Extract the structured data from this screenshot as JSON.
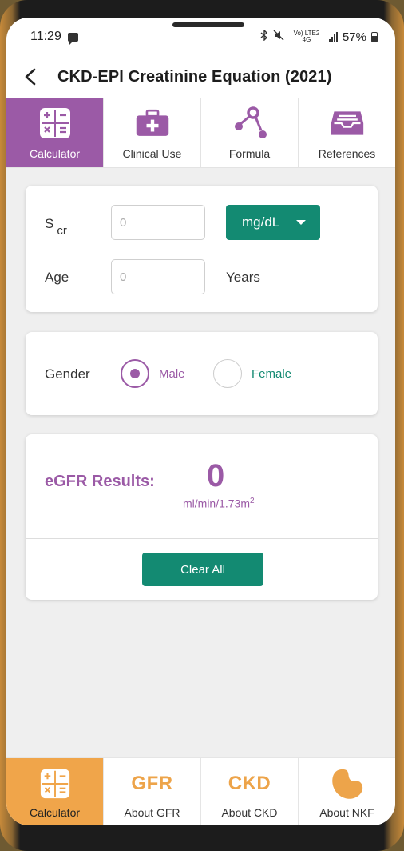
{
  "status_bar": {
    "time": "11:29",
    "indicators": "Vo) LTE2 4G",
    "battery": "57%"
  },
  "header": {
    "title": "CKD-EPI Creatinine Equation (2021)"
  },
  "top_tabs": [
    {
      "label": "Calculator",
      "icon": "calculator-icon",
      "active": true
    },
    {
      "label": "Clinical Use",
      "icon": "medical-kit-icon",
      "active": false
    },
    {
      "label": "Formula",
      "icon": "formula-nodes-icon",
      "active": false
    },
    {
      "label": "References",
      "icon": "inbox-tray-icon",
      "active": false
    }
  ],
  "form": {
    "scr_label_main": "S",
    "scr_label_sub": "cr",
    "scr_placeholder": "0",
    "unit_selected": "mg/dL",
    "age_label": "Age",
    "age_placeholder": "0",
    "age_unit": "Years",
    "gender_label": "Gender",
    "gender_options": [
      {
        "label": "Male",
        "selected": true
      },
      {
        "label": "Female",
        "selected": false
      }
    ]
  },
  "results": {
    "label": "eGFR Results:",
    "value": "0",
    "unit_main": "ml/min/1.73m",
    "unit_sup": "2",
    "clear_label": "Clear All"
  },
  "bottom_nav": [
    {
      "label": "Calculator",
      "icon": "calculator-icon",
      "active": true
    },
    {
      "label": "About GFR",
      "icon_text": "GFR",
      "active": false
    },
    {
      "label": "About CKD",
      "icon_text": "CKD",
      "active": false
    },
    {
      "label": "About NKF",
      "icon": "kidney-icon",
      "active": false
    }
  ],
  "colors": {
    "purple": "#9b5aa6",
    "teal": "#138a72",
    "orange": "#f0a54a"
  }
}
